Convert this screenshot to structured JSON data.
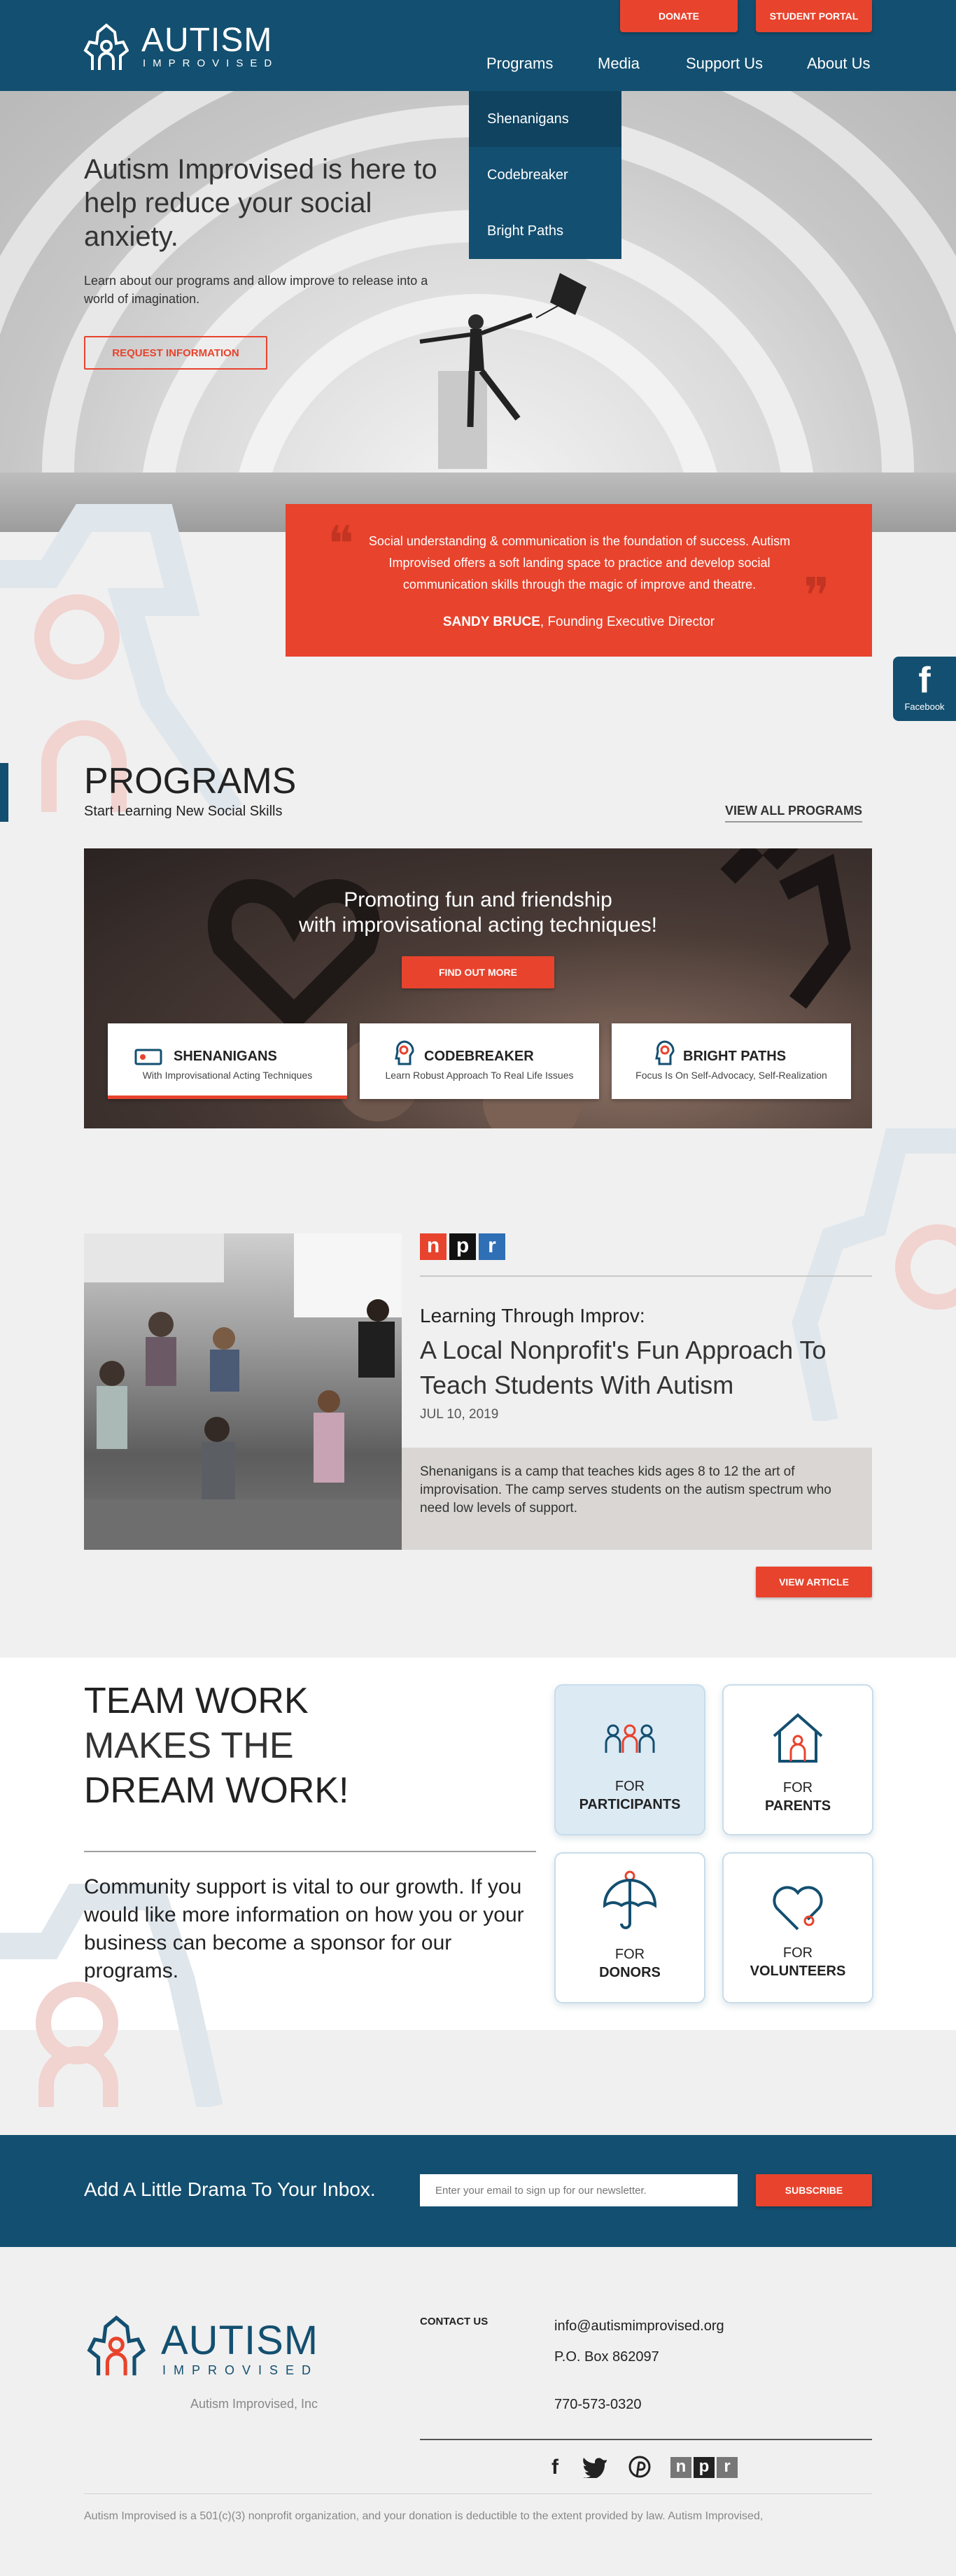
{
  "header": {
    "logo_title": "AUTISM",
    "logo_subtitle": "IMPROVISED",
    "donate": "DONATE",
    "student_portal": "STUDENT PORTAL",
    "nav": [
      "Programs",
      "Media",
      "Support Us",
      "About Us"
    ],
    "dropdown": [
      "Shenanigans",
      "Codebreaker",
      "Bright Paths"
    ]
  },
  "hero": {
    "title": "Autism Improvised is here to help reduce your social anxiety.",
    "text": "Learn about our programs and allow improve to release into a world of imagination.",
    "cta": "REQUEST INFORMATION"
  },
  "quote": {
    "text": "Social understanding & communication is the foundation of success. Autism Improvised offers a soft landing space to practice and develop social communication skills through the magic of improve and theatre.",
    "author": "SANDY BRUCE",
    "role": ", Founding Executive Director"
  },
  "social_tab": {
    "label": "Facebook"
  },
  "programs": {
    "title": "PROGRAMS",
    "subtitle": "Start Learning New Social Skills",
    "view_all": "VIEW ALL PROGRAMS",
    "promo_line1": "Promoting fun and friendship",
    "promo_line2": "with improvisational acting techniques!",
    "find_out": "FIND OUT MORE",
    "cards": [
      {
        "title": "SHENANIGANS",
        "sub": "With Improvisational Acting Techniques"
      },
      {
        "title": "CODEBREAKER",
        "sub": "Learn Robust Approach To Real Life Issues"
      },
      {
        "title": "BRIGHT PATHS",
        "sub": "Focus Is On Self-Advocacy, Self-Realization"
      }
    ]
  },
  "article": {
    "source_letters": [
      "n",
      "p",
      "r"
    ],
    "kicker": "Learning Through Improv:",
    "title": "A Local Nonprofit's Fun Approach To Teach Students With Autism",
    "date": "JUL 10, 2019",
    "summary": "Shenanigans is a camp that teaches kids ages 8 to 12 the art of improvisation. The camp serves students on the autism spectrum who need low levels of support.",
    "cta": "VIEW ARTICLE"
  },
  "teamwork": {
    "line1": "TEAM WORK",
    "line2": "MAKES THE",
    "line3": "DREAM WORK!",
    "text": "Community support is vital to our growth.  If you would like more information on how you or your business can become a sponsor for our programs.",
    "tiles": [
      {
        "for": "FOR",
        "who": "PARTICIPANTS"
      },
      {
        "for": "FOR",
        "who": "PARENTS"
      },
      {
        "for": "FOR",
        "who": "DONORS"
      },
      {
        "for": "FOR",
        "who": "VOLUNTEERS"
      }
    ]
  },
  "newsletter": {
    "title": "Add A Little Drama To Your Inbox.",
    "placeholder": "Enter your email to sign up for our newsletter.",
    "button": "SUBSCRIBE"
  },
  "footer": {
    "company": "Autism Improvised, Inc",
    "contact_heading": "CONTACT US",
    "email": "info@autismimprovised.org",
    "po_box": "P.O. Box 862097",
    "phone": "770-573-0320",
    "disclaimer": "Autism Improvised is a 501(c)(3) nonprofit organization, and your donation is deductible to the extent provided by law. Autism Improvised,"
  },
  "colors": {
    "navy": "#134f70",
    "accent": "#e8432d",
    "light_blue": "#dceaf4"
  }
}
